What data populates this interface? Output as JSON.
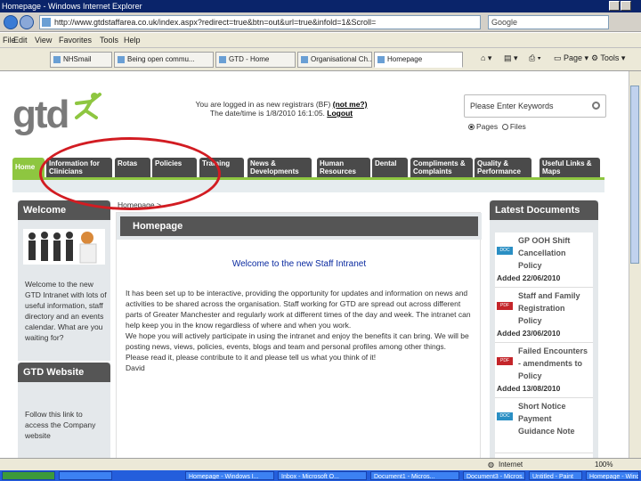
{
  "window": {
    "title": "Homepage - Windows Internet Explorer",
    "address": "http://www.gtdstaffarea.co.uk/index.aspx?redirect=true&btn=out&url=true&infold=1&Scroll=",
    "search_placeholder": "Google"
  },
  "menu": [
    "File",
    "Edit",
    "View",
    "Favorites",
    "Tools",
    "Help"
  ],
  "tabs": [
    "NHSmail",
    "Being open commu...",
    "GTD - Home",
    "Organisational Ch...",
    "Homepage"
  ],
  "toolbar": {
    "page": "Page",
    "tools": "Tools"
  },
  "site": {
    "logo": "gtd",
    "login": {
      "line1": "You are logged in as new registrars (BF)",
      "not_me": "(not me?)",
      "line2": "The date/time is 1/8/2010 16:1:05.",
      "logout": "Logout"
    },
    "search": {
      "placeholder": "Please Enter Keywords",
      "opt_pages": "Pages",
      "opt_files": "Files"
    },
    "nav": [
      {
        "label": "Home"
      },
      {
        "label": "Information for Clinicians"
      },
      {
        "label": "Rotas"
      },
      {
        "label": "Policies"
      },
      {
        "label": "Training"
      },
      {
        "label": "News & Developments"
      },
      {
        "label": "Human Resources"
      },
      {
        "label": "Dental"
      },
      {
        "label": "Compliments & Complaints"
      },
      {
        "label": "Quality & Performance"
      },
      {
        "label": "Useful Links & Maps"
      }
    ],
    "welcome_panel": {
      "title": "Welcome",
      "text": "Welcome to the new GTD Intranet with lots of useful information, staff directory and an events calendar. What are you waiting for?"
    },
    "gtd_website": {
      "title": "GTD Website",
      "text": "Follow this link to access the Company website"
    },
    "breadcrumb": "Homepage >",
    "main": {
      "title": "Homepage",
      "heading": "Welcome to the new Staff Intranet",
      "para1": "It has been set up to be interactive, providing the opportunity for updates and information on news and activities to be shared across the organisation. Staff working for GTD are spread out across different parts of Greater Manchester and regularly work at different times of the day and week. The intranet can help keep you in the know regardless of where and when you work.",
      "para2": "We hope you will actively participate in using the intranet and enjoy the benefits it can bring. We will be posting news, views, policies, events, blogs and team and personal profiles among other things.",
      "para3": "Please read it, please contribute to it and please tell us what you think of it!",
      "sign": "David"
    },
    "latest": {
      "title": "Latest Documents",
      "docs": [
        {
          "title": "GP OOH Shift Cancellation Policy",
          "added": "Added 22/06/2010",
          "type": "DOC",
          "color": "#2a8fc4"
        },
        {
          "title": "Staff and Family Registration Policy",
          "added": "Added 23/06/2010",
          "type": "PDF",
          "color": "#c4252a"
        },
        {
          "title": "Failed Encounters - amendments to Policy",
          "added": "Added 13/08/2010",
          "type": "PDF",
          "color": "#c4252a"
        },
        {
          "title": "Short Notice Payment Guidance Note",
          "added": "",
          "type": "DOC",
          "color": "#2a8fc4"
        }
      ]
    }
  },
  "status": {
    "zone": "Internet",
    "zoom": "100%"
  },
  "taskbar": [
    "",
    "",
    "Homepage - Windows I...",
    "Inbox - Microsoft O...",
    "Document1 - Micros...",
    "Document3 - Micros...",
    "Untitled - Paint",
    "Homepage - Windo..."
  ]
}
